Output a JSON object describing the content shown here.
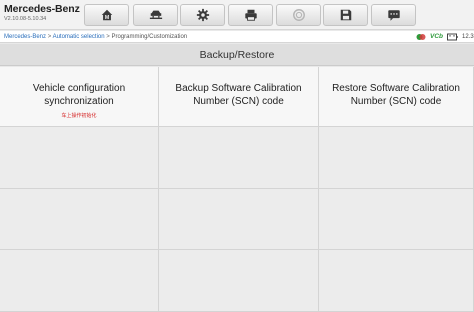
{
  "app": {
    "brand": "Mercedes-Benz",
    "version": "V2.10.08-5.10.34"
  },
  "toolbar": {
    "buttons": [
      {
        "name": "home-button",
        "icon": "home-icon"
      },
      {
        "name": "vehicle-swap-button",
        "icon": "car-lift-icon"
      },
      {
        "name": "settings-button",
        "icon": "gear-icon"
      },
      {
        "name": "print-button",
        "icon": "printer-icon"
      },
      {
        "name": "remote-button",
        "icon": "remote-icon"
      },
      {
        "name": "save-button",
        "icon": "save-icon"
      },
      {
        "name": "message-button",
        "icon": "message-icon"
      }
    ]
  },
  "breadcrumb": {
    "items": [
      "Mercedes-Benz",
      "Automatic selection",
      "Programming/Customization"
    ],
    "separator": ">"
  },
  "status": {
    "vcb_label": "VCb",
    "voltage": "12.3"
  },
  "page": {
    "title": "Backup/Restore"
  },
  "functions": [
    {
      "title": "Vehicle configuration synchronization",
      "note": "车上操作初始化"
    },
    {
      "title": "Backup Software Calibration Number (SCN) code",
      "note": ""
    },
    {
      "title": "Restore Software Calibration Number (SCN) code",
      "note": ""
    }
  ],
  "colors": {
    "link": "#2a6ebb",
    "note_red": "#d42020",
    "vcb_green": "#2d9a3a"
  }
}
